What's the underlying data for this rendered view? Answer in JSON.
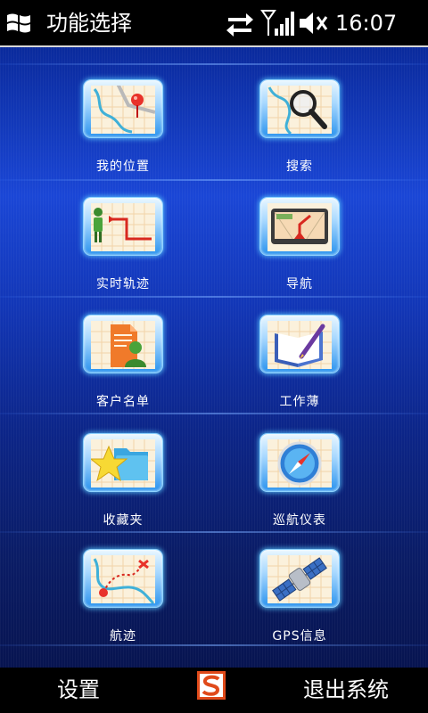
{
  "status": {
    "title": "功能选择",
    "time": "16:07",
    "icons": [
      "windows-logo-icon",
      "data-transfer-icon",
      "signal-strength-icon",
      "speaker-muted-icon"
    ]
  },
  "menu": {
    "items": [
      {
        "label": "我的位置",
        "icon": "map-pin-icon"
      },
      {
        "label": "搜索",
        "icon": "magnifier-map-icon"
      },
      {
        "label": "实时轨迹",
        "icon": "track-person-icon"
      },
      {
        "label": "导航",
        "icon": "navigator-device-icon"
      },
      {
        "label": "客户名单",
        "icon": "client-list-icon"
      },
      {
        "label": "工作薄",
        "icon": "notebook-pen-icon"
      },
      {
        "label": "收藏夹",
        "icon": "star-folder-icon"
      },
      {
        "label": "巡航仪表",
        "icon": "compass-icon"
      },
      {
        "label": "航迹",
        "icon": "route-map-icon"
      },
      {
        "label": "GPS信息",
        "icon": "satellite-icon"
      }
    ]
  },
  "softkeys": {
    "left": "设置",
    "right": "退出系统",
    "ime_icon": "sogou-input-icon"
  },
  "colors": {
    "background_top": "#1a46d6",
    "background_bottom": "#071450",
    "icon_glow": "#5ac8ff",
    "text": "#ffffff"
  }
}
